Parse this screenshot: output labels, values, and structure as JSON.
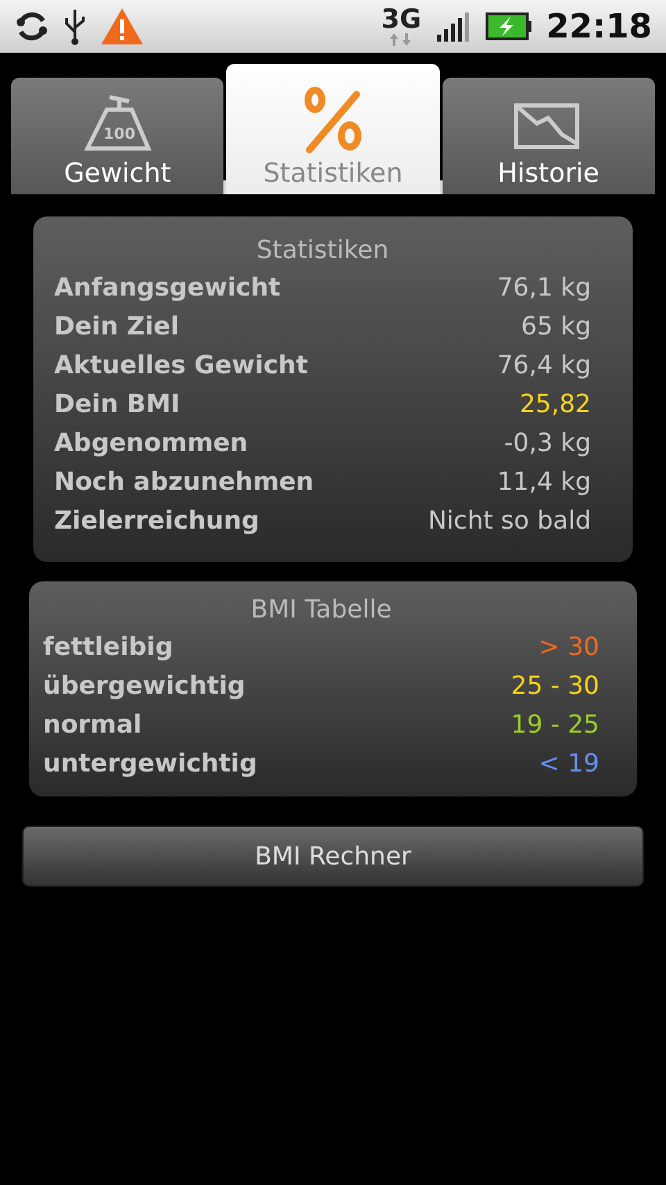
{
  "status_bar": {
    "network": "3G",
    "time": "22:18"
  },
  "tabs": [
    {
      "label": "Gewicht",
      "kind": "weight",
      "icon_label": "100",
      "selected": false
    },
    {
      "label": "Statistiken",
      "kind": "percent",
      "selected": true
    },
    {
      "label": "Historie",
      "kind": "chart",
      "selected": false
    }
  ],
  "stats": {
    "title": "Statistiken",
    "rows": [
      {
        "label": "Anfangsgewicht",
        "value": "76,1 kg",
        "color": "#c8c8c8"
      },
      {
        "label": "Dein Ziel",
        "value": "65 kg",
        "color": "#c8c8c8"
      },
      {
        "label": "Aktuelles Gewicht",
        "value": "76,4 kg",
        "color": "#c8c8c8"
      },
      {
        "label": "Dein BMI",
        "value": "25,82",
        "color": "#f5d31c"
      },
      {
        "label": "Abgenommen",
        "value": "-0,3 kg",
        "color": "#c8c8c8"
      },
      {
        "label": "Noch abzunehmen",
        "value": "11,4 kg",
        "color": "#c8c8c8"
      },
      {
        "label": "Zielerreichung",
        "value": "Nicht so bald",
        "color": "#c8c8c8"
      }
    ]
  },
  "bmi_table": {
    "title": "BMI Tabelle",
    "rows": [
      {
        "label": "fettleibig",
        "value": "> 30",
        "color": "#f06a1e"
      },
      {
        "label": "übergewichtig",
        "value": "25 - 30",
        "color": "#f5d31c"
      },
      {
        "label": "normal",
        "value": "19 - 25",
        "color": "#9ccc2c"
      },
      {
        "label": "untergewichtig",
        "value": "< 19",
        "color": "#6a8ef0"
      }
    ]
  },
  "button": "BMI Rechner"
}
